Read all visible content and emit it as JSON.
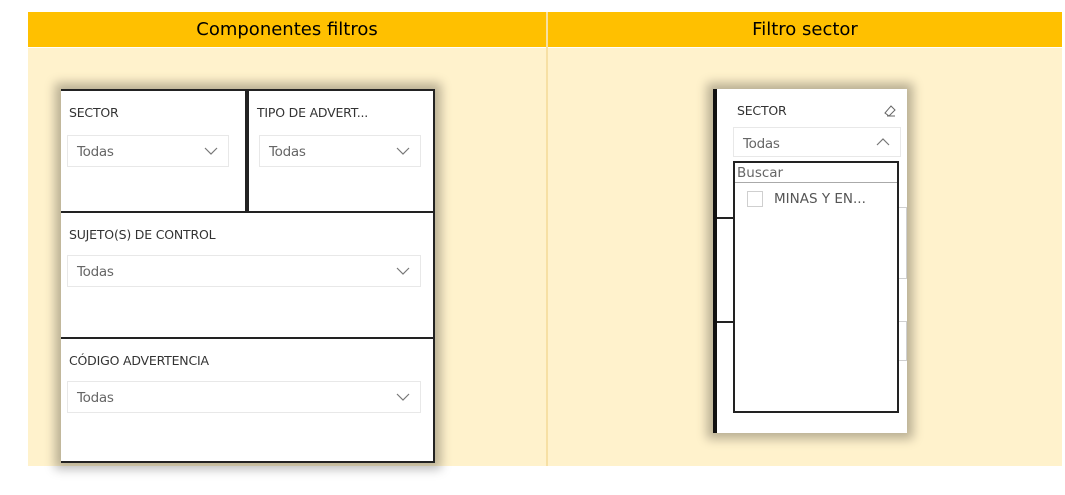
{
  "table": {
    "left_header": "Componentes filtros",
    "right_header": "Filtro sector"
  },
  "colors": {
    "header_bg": "#ffc000",
    "cell_bg": "#fff2cc"
  },
  "left_screenshot": {
    "sector": {
      "label": "SECTOR",
      "value": "Todas"
    },
    "tipo": {
      "label": "TIPO DE ADVERT...",
      "value": "Todas"
    },
    "sujeto": {
      "label": "SUJETO(S) DE CONTROL",
      "value": "Todas"
    },
    "codigo": {
      "label": "CÓDIGO ADVERTENCIA",
      "value": "Todas"
    }
  },
  "right_screenshot": {
    "sector_label": "SECTOR",
    "value": "Todas",
    "search_placeholder": "Buscar",
    "options": [
      "MINAS Y EN..."
    ]
  }
}
